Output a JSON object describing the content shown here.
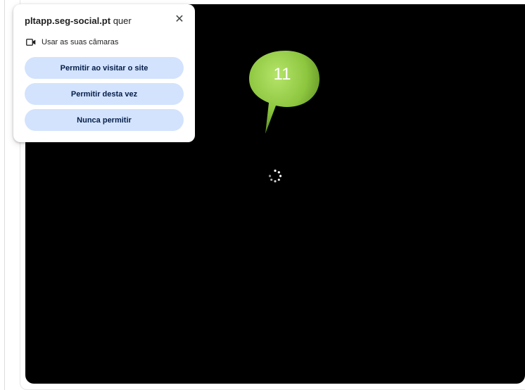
{
  "popup": {
    "host": "pltapp.seg-social.pt",
    "suffix": " quer",
    "close_symbol": "✕",
    "permission": {
      "icon": "camera-icon",
      "label": "Usar as suas câmaras"
    },
    "buttons": [
      {
        "label": "Permitir ao visitar o site"
      },
      {
        "label": "Permitir desta vez"
      },
      {
        "label": "Nunca permitir"
      }
    ]
  },
  "annotation": {
    "number": "11",
    "color": "#8dc63f"
  },
  "video": {
    "background": "#000000",
    "state_icon": "loading-spinner-icon"
  }
}
